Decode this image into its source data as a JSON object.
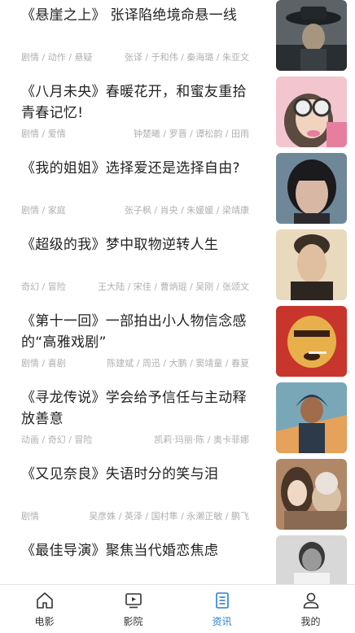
{
  "articles": [
    {
      "title": "《悬崖之上》 张译陷绝境命悬一线",
      "genre": "剧情 / 动作 / 悬疑",
      "cast": "张译 / 于和伟 / 秦海璐 / 朱亚文",
      "thumb_colors": [
        "#3a3f44",
        "#6b6f72",
        "#1d2124"
      ]
    },
    {
      "title": "《八月未央》春暖花开，和蜜友重拾青春记忆!",
      "genre": "剧情 / 爱情",
      "cast": "钟楚曦 / 罗晋 / 谭松韵 / 田雨",
      "thumb_colors": [
        "#f3c6cf",
        "#e67ea0",
        "#5a4a3f"
      ]
    },
    {
      "title": "《我的姐姐》选择爱还是选择自由?",
      "genre": "剧情 / 家庭",
      "cast": "张子枫 / 肖央 / 朱媛媛 / 梁靖康",
      "thumb_colors": [
        "#6f8899",
        "#c9a99a",
        "#1b1a1c"
      ]
    },
    {
      "title": "《超级的我》梦中取物逆转人生",
      "genre": "奇幻 / 冒险",
      "cast": "王大陆 / 宋佳 / 曹炳琨 / 吴刚 / 张颂文",
      "thumb_colors": [
        "#d8c7a8",
        "#e9d9bd",
        "#3b3026"
      ]
    },
    {
      "title": "《第十一回》一部拍出小人物信念感的“高雅戏剧”",
      "genre": "剧情 / 喜剧",
      "cast": "陈建斌 / 周迅 / 大鹏 / 窦靖童 / 春夏",
      "thumb_colors": [
        "#c8352c",
        "#e8b04a",
        "#3a1f14"
      ]
    },
    {
      "title": "《寻龙传说》学会给予信任与主动释放善意",
      "genre": "动画 / 奇幻 / 冒险",
      "cast": "凯莉·玛丽·陈 / 奥卡菲娜",
      "thumb_colors": [
        "#7aa7b8",
        "#e6a15a",
        "#2d3a4a"
      ]
    },
    {
      "title": "《又见奈良》失语时分的笑与泪",
      "genre": "剧情",
      "cast": "吴彦姝 / 英泽 / 国村隼 / 永濑正敏 / 鹏飞",
      "thumb_colors": [
        "#b08868",
        "#d8c0a4",
        "#4a3628"
      ]
    },
    {
      "title": "《最佳导演》聚焦当代婚恋焦虑",
      "genre": "",
      "cast": "",
      "thumb_colors": [
        "#cfcfcf",
        "#9a9a9a",
        "#3a3a3a"
      ]
    }
  ],
  "tabbar": {
    "tabs": [
      {
        "label": "电影",
        "icon": "home-icon"
      },
      {
        "label": "影院",
        "icon": "tv-icon"
      },
      {
        "label": "资讯",
        "icon": "document-icon"
      },
      {
        "label": "我的",
        "icon": "user-icon"
      }
    ],
    "active_index": 2,
    "active_color": "#2a7fd4",
    "inactive_color": "#333333"
  }
}
